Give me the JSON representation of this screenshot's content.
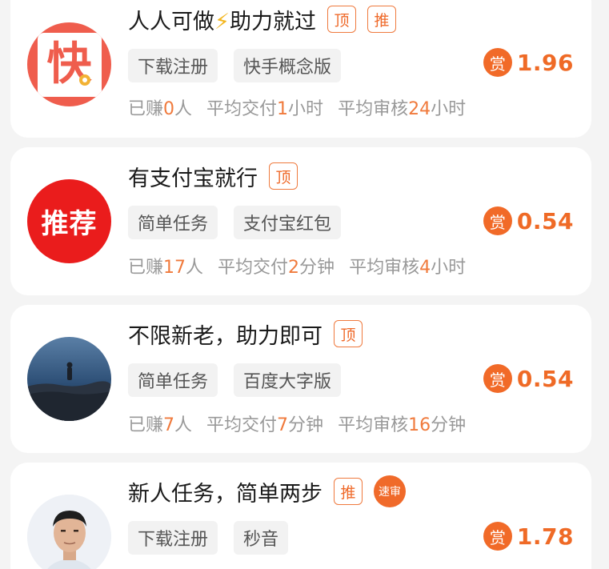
{
  "tasks": [
    {
      "title_prefix": "人人可做",
      "title_icon": "⚡",
      "title_suffix": "助力就过",
      "badges": [
        "顶",
        "推"
      ],
      "tags": [
        "下载注册",
        "快手概念版"
      ],
      "avatar_text": "快",
      "reward_icon": "赏",
      "reward": "1.96",
      "stats": [
        {
          "pre": "已赚",
          "num": "0",
          "post": "人"
        },
        {
          "pre": "平均交付",
          "num": "1",
          "post": "小时"
        },
        {
          "pre": "平均审核",
          "num": "24",
          "post": "小时"
        }
      ]
    },
    {
      "title": "有支付宝就行",
      "badges": [
        "顶"
      ],
      "tags": [
        "简单任务",
        "支付宝红包"
      ],
      "avatar_text": "推荐",
      "reward_icon": "赏",
      "reward": "0.54",
      "stats": [
        {
          "pre": "已赚",
          "num": "17",
          "post": "人"
        },
        {
          "pre": "平均交付",
          "num": "2",
          "post": "分钟"
        },
        {
          "pre": "平均审核",
          "num": "4",
          "post": "小时"
        }
      ]
    },
    {
      "title": "不限新老，助力即可",
      "badges": [
        "顶"
      ],
      "tags": [
        "简单任务",
        "百度大字版"
      ],
      "reward_icon": "赏",
      "reward": "0.54",
      "stats": [
        {
          "pre": "已赚",
          "num": "7",
          "post": "人"
        },
        {
          "pre": "平均交付",
          "num": "7",
          "post": "分钟"
        },
        {
          "pre": "平均审核",
          "num": "16",
          "post": "分钟"
        }
      ]
    },
    {
      "title": "新人任务，简单两步",
      "badges": [
        "推"
      ],
      "fast_badge": "速审",
      "tags": [
        "下载注册",
        "秒音"
      ],
      "reward_icon": "赏",
      "reward": "1.78"
    }
  ],
  "colors": {
    "accent": "#ef6a26",
    "badge_border": "#ef7a3e",
    "tag_bg": "#f2f2f2",
    "stat_text": "#999999"
  }
}
